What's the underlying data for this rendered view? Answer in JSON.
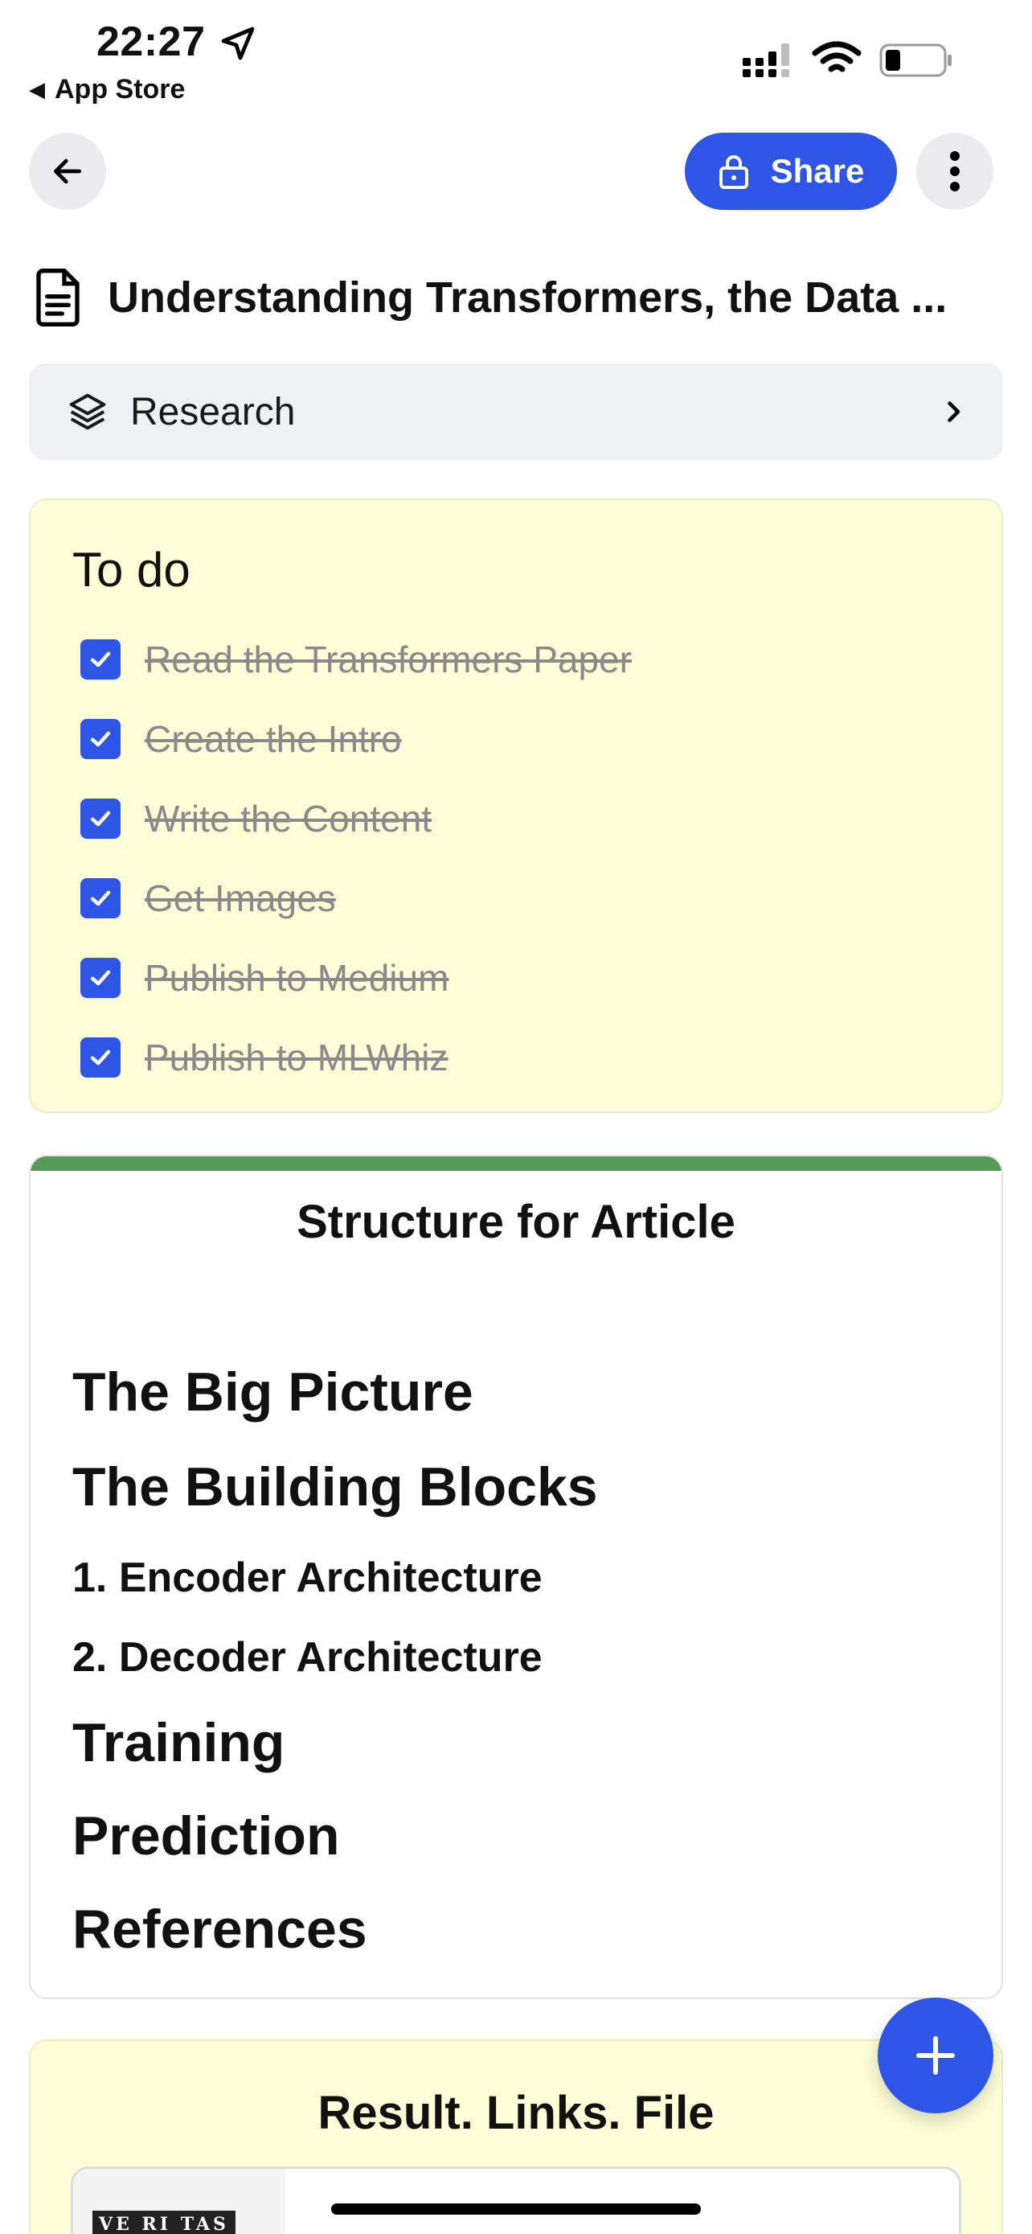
{
  "status_bar": {
    "time": "22:27",
    "back_app": "App Store"
  },
  "header": {
    "share_label": "Share"
  },
  "document": {
    "title": "Understanding Transformers, the Data ...",
    "folder": "Research"
  },
  "todo": {
    "title": "To do",
    "items": [
      {
        "label": "Read the Transformers Paper",
        "checked": true
      },
      {
        "label": "Create the Intro",
        "checked": true
      },
      {
        "label": "Write the Content",
        "checked": true
      },
      {
        "label": "Get Images",
        "checked": true
      },
      {
        "label": "Publish to Medium",
        "checked": true
      },
      {
        "label": "Publish to MLWhiz",
        "checked": true
      }
    ]
  },
  "structure": {
    "title": "Structure for Article",
    "items": [
      {
        "text": "The Big Picture",
        "level": "h1"
      },
      {
        "text": "The Building Blocks",
        "level": "h1"
      },
      {
        "text": "1. Encoder Architecture",
        "level": "h3"
      },
      {
        "text": "2. Decoder Architecture",
        "level": "h3"
      },
      {
        "text": "Training",
        "level": "h1"
      },
      {
        "text": "Prediction",
        "level": "h1"
      },
      {
        "text": "References",
        "level": "h1"
      }
    ]
  },
  "result": {
    "title": "Result. Links. File",
    "thumb_text": "VE RI TAS"
  },
  "colors": {
    "accent": "#2f55e6",
    "todo_bg": "#fdfed7",
    "structure_topbar": "#559a56"
  },
  "icons": {
    "back": "arrow-left-icon",
    "share": "lock-icon",
    "more": "more-vertical-icon",
    "document": "document-icon",
    "folder": "layers-icon",
    "add": "plus-icon"
  }
}
